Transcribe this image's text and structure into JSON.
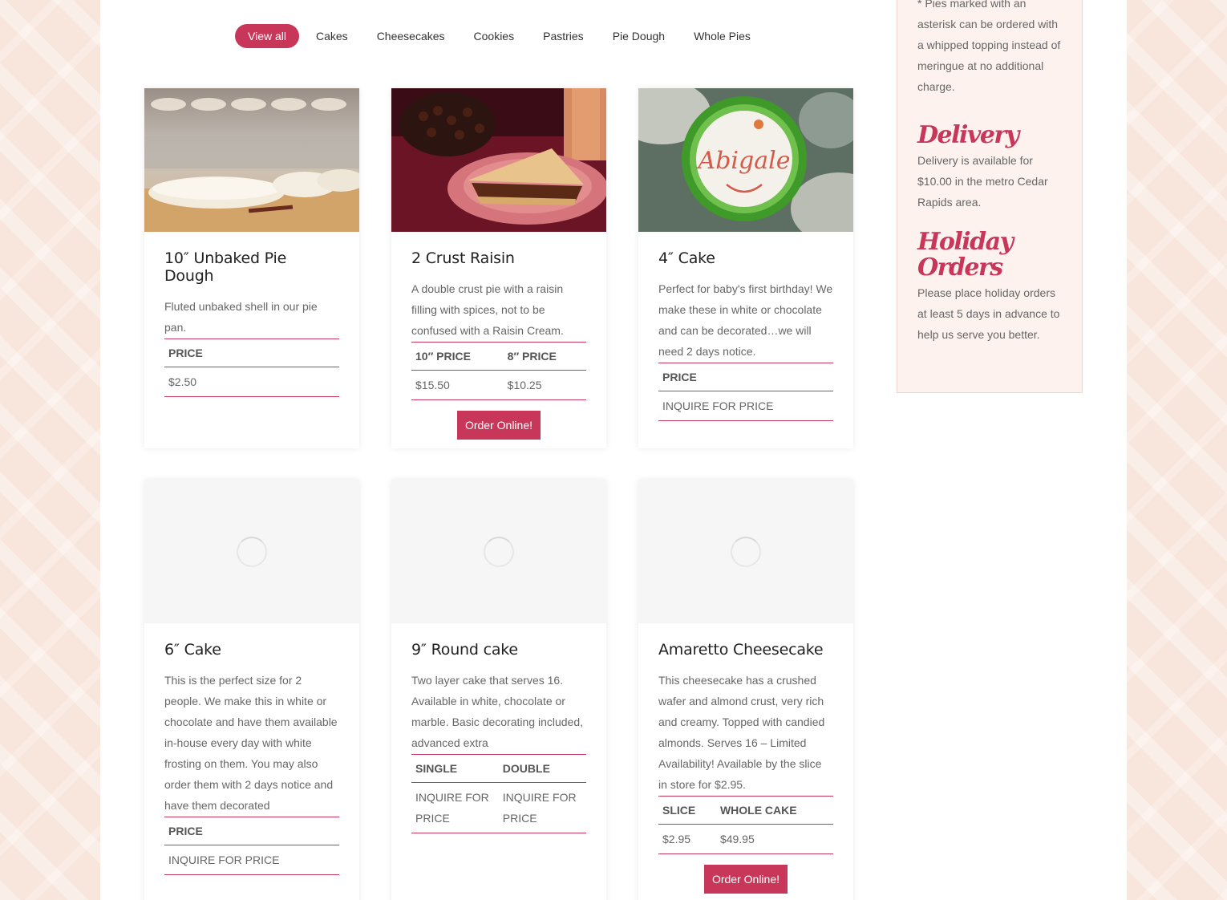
{
  "filters": [
    "View all",
    "Cakes",
    "Cheesecakes",
    "Cookies",
    "Pastries",
    "Pie Dough",
    "Whole Pies"
  ],
  "sidebar": {
    "note": "* Pies marked with an asterisk can be ordered with a whipped topping instead of meringue at no additional charge.",
    "delivery_title": "Delivery",
    "delivery_text": "Delivery is available for $10.00 in the metro Cedar Rapids area.",
    "holiday_title": "Holiday Orders",
    "holiday_text": "Please place holiday orders at least 5 days in advance to help us serve you better."
  },
  "cards": [
    {
      "title": "10″ Unbaked Pie Dough",
      "description": "Fluted unbaked shell in our pie pan.",
      "headers": [
        "PRICE"
      ],
      "values": [
        "$2.50"
      ]
    },
    {
      "title": "2 Crust Raisin",
      "description": "A double crust pie with a raisin filling with spices, not to be confused with a Raisin Cream.",
      "headers": [
        "10″ PRICE",
        "8″ PRICE"
      ],
      "values": [
        "$15.50",
        "$10.25"
      ],
      "button": "Order Online!"
    },
    {
      "title": "4″ Cake",
      "description": "Perfect for baby's first birthday! We make these in white or chocolate and can be decorated…we will need 2 days notice.",
      "headers": [
        "PRICE"
      ],
      "values": [
        "INQUIRE FOR PRICE"
      ],
      "cake_text": "Abigale"
    },
    {
      "title": "6″ Cake",
      "description": "This is the perfect size for 2 people. We make this in white or chocolate and have them available in-house every day with white frosting on them. You may also order them with 2 days notice and have them decorated",
      "headers": [
        "PRICE"
      ],
      "values": [
        "INQUIRE FOR PRICE"
      ]
    },
    {
      "title": "9″ Round cake",
      "description": "Two layer cake that serves 16. Available in white, chocolate or marble. Basic decorating included, advanced extra",
      "headers": [
        "SINGLE",
        "DOUBLE"
      ],
      "values": [
        "INQUIRE FOR PRICE",
        "INQUIRE FOR PRICE"
      ]
    },
    {
      "title": "Amaretto Cheesecake",
      "description": "This cheesecake has a crushed wafer and almond crust, very rich and creamy. Topped with candied almonds. Serves 16 – Limited Availability! Available by the slice in store for $2.95.",
      "headers": [
        "SLICE",
        "WHOLE CAKE"
      ],
      "values": [
        "$2.95",
        "$49.95"
      ],
      "button": "Order Online!"
    }
  ],
  "colors": {
    "accent": "#c8365a",
    "background": "#f8e6dc"
  }
}
